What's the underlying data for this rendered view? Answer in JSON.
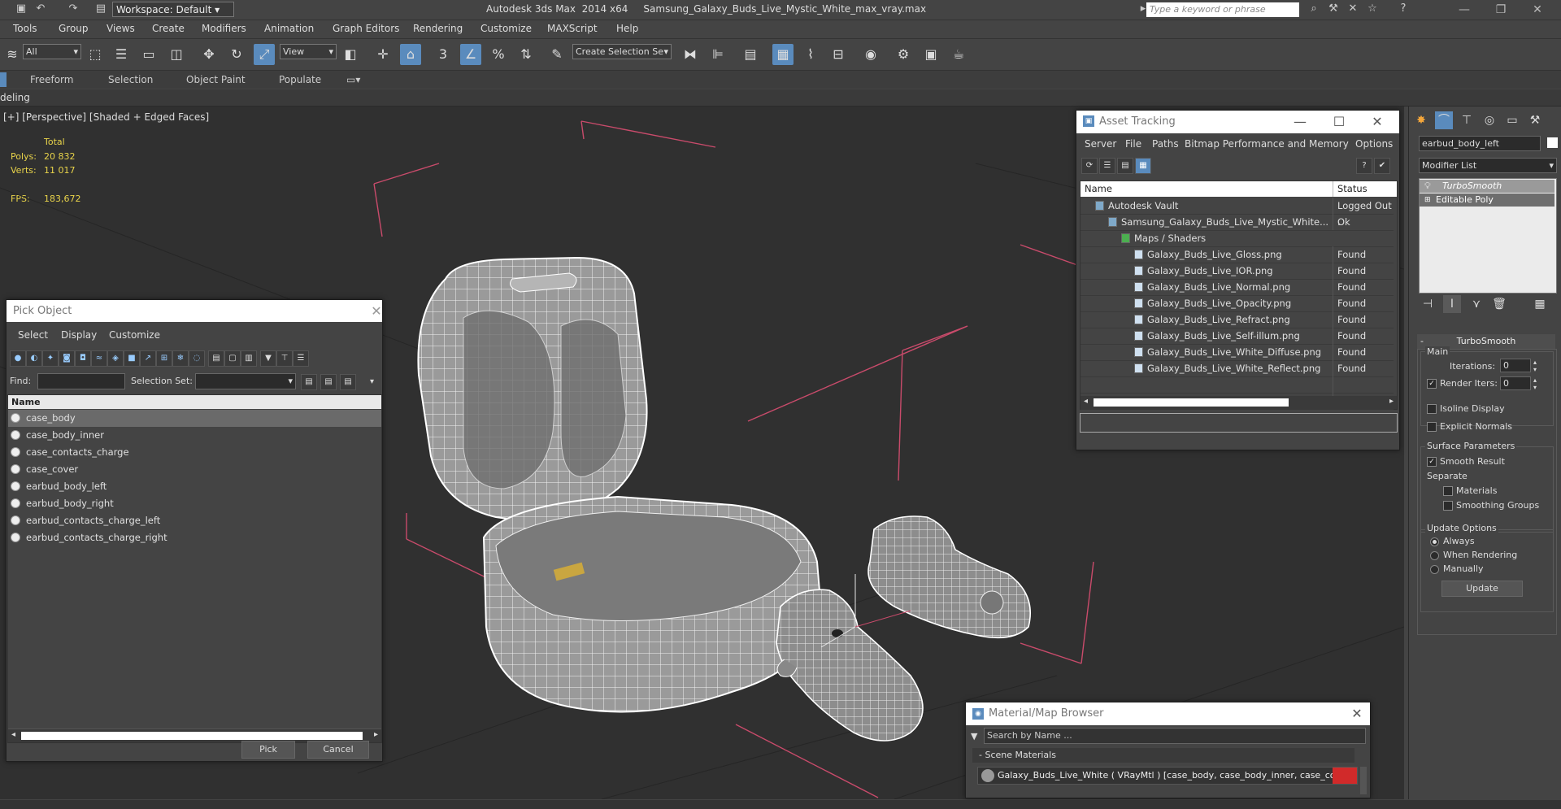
{
  "titlebar": {
    "workspace": "Workspace: Default",
    "title": "Autodesk 3ds Max  2014 x64     Samsung_Galaxy_Buds_Live_Mystic_White_max_vray.max",
    "search_placeholder": "Type a keyword or phrase"
  },
  "menu": [
    "Tools",
    "Group",
    "Views",
    "Create",
    "Modifiers",
    "Animation",
    "Graph Editors",
    "Rendering",
    "Customize",
    "MAXScript",
    "Help"
  ],
  "toolbar": {
    "filter": "All",
    "ref_coord": "View",
    "selection_set_placeholder": "Create Selection Se"
  },
  "ribbon": {
    "tabs": [
      "Freeform",
      "Selection",
      "Object Paint",
      "Populate"
    ],
    "subtab": "deling"
  },
  "viewport": {
    "label": "[+] [Perspective] [Shaded + Edged Faces]",
    "stats_header": "Total",
    "polys_label": "Polys:",
    "polys_value": "20 832",
    "verts_label": "Verts:",
    "verts_value": "11 017",
    "fps_label": "FPS:",
    "fps_value": "183,672"
  },
  "pick_object": {
    "title": "Pick Object",
    "menus": [
      "Select",
      "Display",
      "Customize"
    ],
    "find_label": "Find:",
    "selection_set_label": "Selection Set:",
    "column": "Name",
    "items": [
      "case_body",
      "case_body_inner",
      "case_contacts_charge",
      "case_cover",
      "earbud_body_left",
      "earbud_body_right",
      "earbud_contacts_charge_left",
      "earbud_contacts_charge_right"
    ],
    "pick_button": "Pick",
    "cancel_button": "Cancel"
  },
  "asset_tracking": {
    "title": "Asset Tracking",
    "menus": [
      "Server",
      "File",
      "Paths",
      "Bitmap Performance and Memory",
      "Options"
    ],
    "col_name": "Name",
    "col_status": "Status",
    "rows": [
      {
        "name": "Autodesk Vault",
        "status": "Logged Out ."
      },
      {
        "name": "Samsung_Galaxy_Buds_Live_Mystic_White...",
        "status": "Ok"
      },
      {
        "name": "Maps / Shaders",
        "status": ""
      },
      {
        "name": "Galaxy_Buds_Live_Gloss.png",
        "status": "Found"
      },
      {
        "name": "Galaxy_Buds_Live_IOR.png",
        "status": "Found"
      },
      {
        "name": "Galaxy_Buds_Live_Normal.png",
        "status": "Found"
      },
      {
        "name": "Galaxy_Buds_Live_Opacity.png",
        "status": "Found"
      },
      {
        "name": "Galaxy_Buds_Live_Refract.png",
        "status": "Found"
      },
      {
        "name": "Galaxy_Buds_Live_Self-illum.png",
        "status": "Found"
      },
      {
        "name": "Galaxy_Buds_Live_White_Diffuse.png",
        "status": "Found"
      },
      {
        "name": "Galaxy_Buds_Live_White_Reflect.png",
        "status": "Found"
      }
    ]
  },
  "material_browser": {
    "title": "Material/Map Browser",
    "search_placeholder": "Search by Name ...",
    "section": "Scene Materials",
    "material": "Galaxy_Buds_Live_White ( VRayMtl ) [case_body, case_body_inner, case_conta..."
  },
  "command_panel": {
    "object_name": "earbud_body_left",
    "modifier_list": "Modifier List",
    "stack": [
      "TurboSmooth",
      "Editable Poly"
    ],
    "rollout_title": "TurboSmooth",
    "main_label": "Main",
    "iterations_label": "Iterations:",
    "iterations_value": "0",
    "render_iters_label": "Render Iters:",
    "render_iters_value": "0",
    "isoline": "Isoline Display",
    "explicit_normals": "Explicit Normals",
    "surface_params": "Surface Parameters",
    "smooth_result": "Smooth Result",
    "separate": "Separate",
    "materials": "Materials",
    "smoothing_groups": "Smoothing Groups",
    "update_options": "Update Options",
    "always": "Always",
    "when_rendering": "When Rendering",
    "manually": "Manually",
    "update_button": "Update"
  },
  "colors": {
    "accent": "#5a8bbd",
    "stat_yellow": "#e8d34a",
    "viewport_bg": "#303030",
    "gizmo_red": "#c94b6b"
  }
}
